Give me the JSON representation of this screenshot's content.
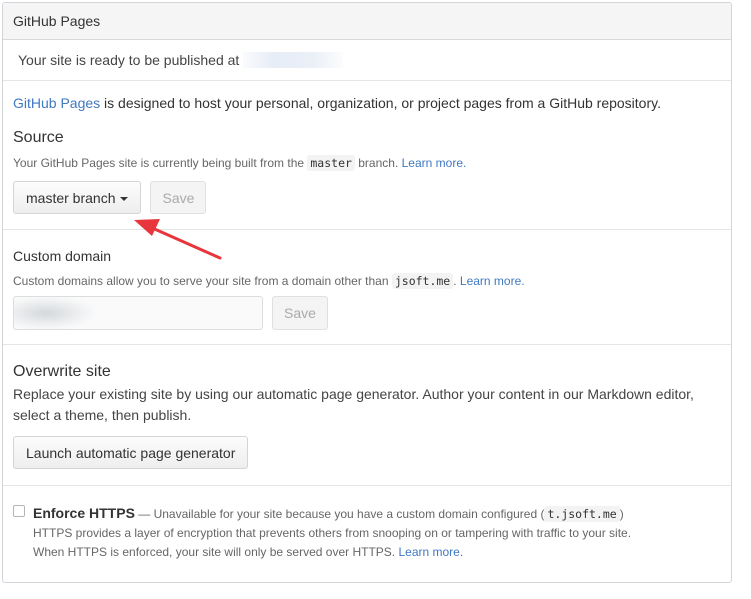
{
  "header": {
    "title": "GitHub Pages"
  },
  "ready": {
    "text": "Your site is ready to be published at "
  },
  "intro": {
    "link": "GitHub Pages",
    "rest": " is designed to host your personal, organization, or project pages from a GitHub repository."
  },
  "source": {
    "title": "Source",
    "desc_before": "Your GitHub Pages site is currently being built from the ",
    "desc_code": "master",
    "desc_after": " branch. ",
    "learn_more": "Learn more.",
    "branch_button": "master branch",
    "save_button": "Save"
  },
  "custom_domain": {
    "title": "Custom domain",
    "desc_before": "Custom domains allow you to serve your site from a domain other than ",
    "desc_code": "jsoft.me",
    "desc_after": ". ",
    "learn_more": "Learn more.",
    "input_value": "",
    "save_button": "Save"
  },
  "overwrite": {
    "title": "Overwrite site",
    "desc": "Replace your existing site by using our automatic page generator. Author your content in our Markdown editor, select a theme, then publish.",
    "button": "Launch automatic page generator"
  },
  "https": {
    "title": "Enforce HTTPS",
    "note_before": " — Unavailable for your site because you have a custom domain configured (",
    "note_code": "t.jsoft.me",
    "note_after": ")",
    "line2": "HTTPS provides a layer of encryption that prevents others from snooping on or tampering with traffic to your site.",
    "line3_before": "When HTTPS is enforced, your site will only be served over HTTPS. ",
    "learn_more": "Learn more."
  },
  "colors": {
    "link": "#4078c0",
    "arrow": "#e8373c",
    "header_bg": "#f5f5f5"
  }
}
